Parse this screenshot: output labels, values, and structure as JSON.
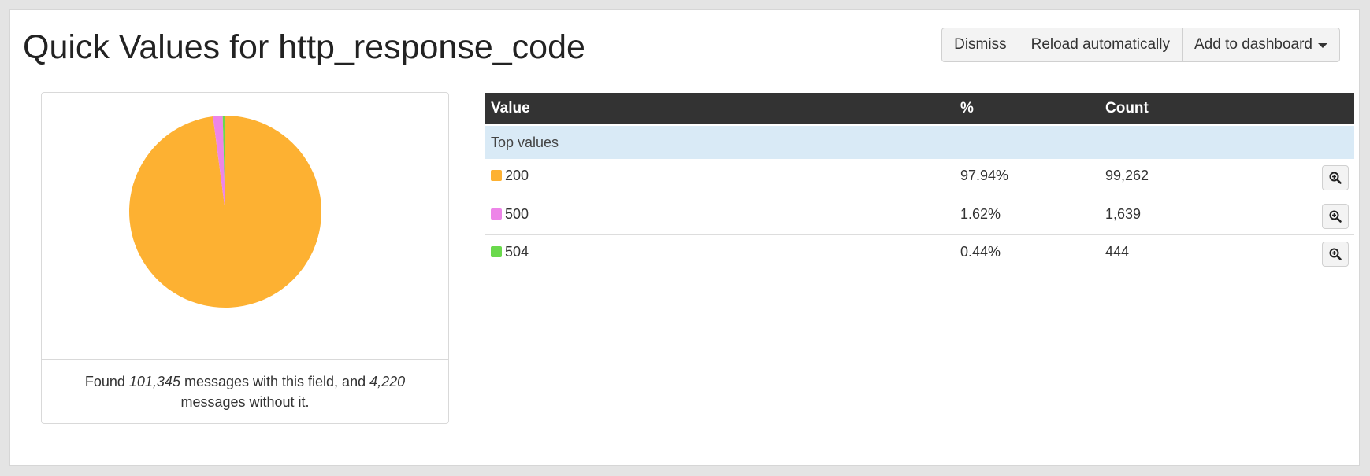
{
  "title": "Quick Values for http_response_code",
  "toolbar": {
    "dismiss_label": "Dismiss",
    "reload_label": "Reload automatically",
    "add_dashboard_label": "Add to dashboard"
  },
  "summary": {
    "prefix": "Found ",
    "with_count": "101,345",
    "middle": " messages with this field, and ",
    "without_count": "4,220",
    "suffix": " messages without it."
  },
  "table": {
    "headers": {
      "value": "Value",
      "percent": "%",
      "count": "Count"
    },
    "group_label": "Top values",
    "rows": [
      {
        "value": "200",
        "percent": "97.94%",
        "count": "99,262",
        "color": "#FDB132"
      },
      {
        "value": "500",
        "percent": "1.62%",
        "count": "1,639",
        "color": "#ED85E8"
      },
      {
        "value": "504",
        "percent": "0.44%",
        "count": "444",
        "color": "#6AD94C"
      }
    ]
  },
  "chart_data": {
    "type": "pie",
    "categories": [
      "200",
      "500",
      "504"
    ],
    "values": [
      99262,
      1639,
      444
    ],
    "colors": [
      "#FDB132",
      "#ED85E8",
      "#6AD94C"
    ],
    "title": "",
    "legend": "none"
  }
}
